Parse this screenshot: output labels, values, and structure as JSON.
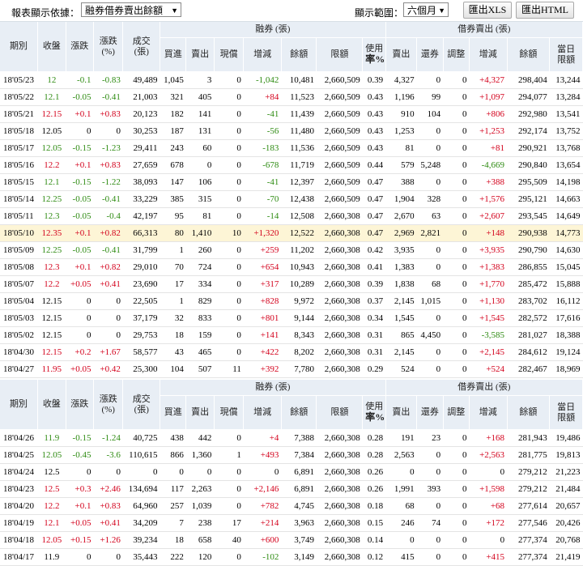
{
  "toolbar": {
    "basis_label": "報表顯示依據：",
    "basis_value": "融券借券賣出餘額",
    "range_label": "顯示範圍：",
    "range_value": "六個月",
    "xls_button": "匯出XLS",
    "html_button": "匯出HTML"
  },
  "header": {
    "date": "期別",
    "close": "收盤",
    "change": "漲跌",
    "pct_a": "漲跌",
    "pct_b": "(%)",
    "vol_a": "成交",
    "vol_b": "(張)",
    "margin_group": "融券 (張)",
    "lending_group": "借券賣出 (張)",
    "buy": "買進",
    "sell": "賣出",
    "spot": "現償",
    "incdec": "增減",
    "balance": "餘額",
    "limit": "限額",
    "usage_a": "使用",
    "usage_b": "率%",
    "l_sell": "賣出",
    "l_return": "還券",
    "l_adjust": "調整",
    "l_incdec": "增減",
    "l_balance": "餘額",
    "l_day_a": "當日",
    "l_day_b": "限額"
  },
  "colors": {
    "up": "#d3001b",
    "down": "#2e8b12",
    "header_bg": "#e8eef5",
    "highlight_bg": "#fdf5d6"
  },
  "rows": [
    {
      "date": "18'05/23",
      "close": "12",
      "chg": "-0.1",
      "pct": "-0.83",
      "vol": "49,489",
      "buy": "1,045",
      "sell": "3",
      "spot": "0",
      "inc": "-1,042",
      "bal": "10,481",
      "lim": "2,660,509",
      "use": "0.39",
      "ls": "4,327",
      "lr": "0",
      "la": "0",
      "li": "+4,327",
      "lb": "298,404",
      "ld": "13,244"
    },
    {
      "date": "18'05/22",
      "close": "12.1",
      "chg": "-0.05",
      "pct": "-0.41",
      "vol": "21,003",
      "buy": "321",
      "sell": "405",
      "spot": "0",
      "inc": "+84",
      "bal": "11,523",
      "lim": "2,660,509",
      "use": "0.43",
      "ls": "1,196",
      "lr": "99",
      "la": "0",
      "li": "+1,097",
      "lb": "294,077",
      "ld": "13,284"
    },
    {
      "date": "18'05/21",
      "close": "12.15",
      "chg": "+0.1",
      "pct": "+0.83",
      "vol": "20,123",
      "buy": "182",
      "sell": "141",
      "spot": "0",
      "inc": "-41",
      "bal": "11,439",
      "lim": "2,660,509",
      "use": "0.43",
      "ls": "910",
      "lr": "104",
      "la": "0",
      "li": "+806",
      "lb": "292,980",
      "ld": "13,541"
    },
    {
      "date": "18'05/18",
      "close": "12.05",
      "chg": "0",
      "pct": "0",
      "vol": "30,253",
      "buy": "187",
      "sell": "131",
      "spot": "0",
      "inc": "-56",
      "bal": "11,480",
      "lim": "2,660,509",
      "use": "0.43",
      "ls": "1,253",
      "lr": "0",
      "la": "0",
      "li": "+1,253",
      "lb": "292,174",
      "ld": "13,752"
    },
    {
      "date": "18'05/17",
      "close": "12.05",
      "chg": "-0.15",
      "pct": "-1.23",
      "vol": "29,411",
      "buy": "243",
      "sell": "60",
      "spot": "0",
      "inc": "-183",
      "bal": "11,536",
      "lim": "2,660,509",
      "use": "0.43",
      "ls": "81",
      "lr": "0",
      "la": "0",
      "li": "+81",
      "lb": "290,921",
      "ld": "13,768"
    },
    {
      "date": "18'05/16",
      "close": "12.2",
      "chg": "+0.1",
      "pct": "+0.83",
      "vol": "27,659",
      "buy": "678",
      "sell": "0",
      "spot": "0",
      "inc": "-678",
      "bal": "11,719",
      "lim": "2,660,509",
      "use": "0.44",
      "ls": "579",
      "lr": "5,248",
      "la": "0",
      "li": "-4,669",
      "lb": "290,840",
      "ld": "13,654"
    },
    {
      "date": "18'05/15",
      "close": "12.1",
      "chg": "-0.15",
      "pct": "-1.22",
      "vol": "38,093",
      "buy": "147",
      "sell": "106",
      "spot": "0",
      "inc": "-41",
      "bal": "12,397",
      "lim": "2,660,509",
      "use": "0.47",
      "ls": "388",
      "lr": "0",
      "la": "0",
      "li": "+388",
      "lb": "295,509",
      "ld": "14,198"
    },
    {
      "date": "18'05/14",
      "close": "12.25",
      "chg": "-0.05",
      "pct": "-0.41",
      "vol": "33,229",
      "buy": "385",
      "sell": "315",
      "spot": "0",
      "inc": "-70",
      "bal": "12,438",
      "lim": "2,660,509",
      "use": "0.47",
      "ls": "1,904",
      "lr": "328",
      "la": "0",
      "li": "+1,576",
      "lb": "295,121",
      "ld": "14,663"
    },
    {
      "date": "18'05/11",
      "close": "12.3",
      "chg": "-0.05",
      "pct": "-0.4",
      "vol": "42,197",
      "buy": "95",
      "sell": "81",
      "spot": "0",
      "inc": "-14",
      "bal": "12,508",
      "lim": "2,660,308",
      "use": "0.47",
      "ls": "2,670",
      "lr": "63",
      "la": "0",
      "li": "+2,607",
      "lb": "293,545",
      "ld": "14,649"
    },
    {
      "date": "18'05/10",
      "close": "12.35",
      "chg": "+0.1",
      "pct": "+0.82",
      "vol": "66,313",
      "buy": "80",
      "sell": "1,410",
      "spot": "10",
      "inc": "+1,320",
      "bal": "12,522",
      "lim": "2,660,308",
      "use": "0.47",
      "ls": "2,969",
      "lr": "2,821",
      "la": "0",
      "li": "+148",
      "lb": "290,938",
      "ld": "14,773",
      "hl": true
    },
    {
      "date": "18'05/09",
      "close": "12.25",
      "chg": "-0.05",
      "pct": "-0.41",
      "vol": "31,799",
      "buy": "1",
      "sell": "260",
      "spot": "0",
      "inc": "+259",
      "bal": "11,202",
      "lim": "2,660,308",
      "use": "0.42",
      "ls": "3,935",
      "lr": "0",
      "la": "0",
      "li": "+3,935",
      "lb": "290,790",
      "ld": "14,630"
    },
    {
      "date": "18'05/08",
      "close": "12.3",
      "chg": "+0.1",
      "pct": "+0.82",
      "vol": "29,010",
      "buy": "70",
      "sell": "724",
      "spot": "0",
      "inc": "+654",
      "bal": "10,943",
      "lim": "2,660,308",
      "use": "0.41",
      "ls": "1,383",
      "lr": "0",
      "la": "0",
      "li": "+1,383",
      "lb": "286,855",
      "ld": "15,045"
    },
    {
      "date": "18'05/07",
      "close": "12.2",
      "chg": "+0.05",
      "pct": "+0.41",
      "vol": "23,690",
      "buy": "17",
      "sell": "334",
      "spot": "0",
      "inc": "+317",
      "bal": "10,289",
      "lim": "2,660,308",
      "use": "0.39",
      "ls": "1,838",
      "lr": "68",
      "la": "0",
      "li": "+1,770",
      "lb": "285,472",
      "ld": "15,888"
    },
    {
      "date": "18'05/04",
      "close": "12.15",
      "chg": "0",
      "pct": "0",
      "vol": "22,505",
      "buy": "1",
      "sell": "829",
      "spot": "0",
      "inc": "+828",
      "bal": "9,972",
      "lim": "2,660,308",
      "use": "0.37",
      "ls": "2,145",
      "lr": "1,015",
      "la": "0",
      "li": "+1,130",
      "lb": "283,702",
      "ld": "16,112"
    },
    {
      "date": "18'05/03",
      "close": "12.15",
      "chg": "0",
      "pct": "0",
      "vol": "37,179",
      "buy": "32",
      "sell": "833",
      "spot": "0",
      "inc": "+801",
      "bal": "9,144",
      "lim": "2,660,308",
      "use": "0.34",
      "ls": "1,545",
      "lr": "0",
      "la": "0",
      "li": "+1,545",
      "lb": "282,572",
      "ld": "17,616"
    },
    {
      "date": "18'05/02",
      "close": "12.15",
      "chg": "0",
      "pct": "0",
      "vol": "29,753",
      "buy": "18",
      "sell": "159",
      "spot": "0",
      "inc": "+141",
      "bal": "8,343",
      "lim": "2,660,308",
      "use": "0.31",
      "ls": "865",
      "lr": "4,450",
      "la": "0",
      "li": "-3,585",
      "lb": "281,027",
      "ld": "18,388"
    },
    {
      "date": "18'04/30",
      "close": "12.15",
      "chg": "+0.2",
      "pct": "+1.67",
      "vol": "58,577",
      "buy": "43",
      "sell": "465",
      "spot": "0",
      "inc": "+422",
      "bal": "8,202",
      "lim": "2,660,308",
      "use": "0.31",
      "ls": "2,145",
      "lr": "0",
      "la": "0",
      "li": "+2,145",
      "lb": "284,612",
      "ld": "19,124"
    },
    {
      "date": "18'04/27",
      "close": "11.95",
      "chg": "+0.05",
      "pct": "+0.42",
      "vol": "25,300",
      "buy": "104",
      "sell": "507",
      "spot": "11",
      "inc": "+392",
      "bal": "7,780",
      "lim": "2,660,308",
      "use": "0.29",
      "ls": "524",
      "lr": "0",
      "la": "0",
      "li": "+524",
      "lb": "282,467",
      "ld": "18,969"
    }
  ],
  "rows2": [
    {
      "date": "18'04/26",
      "close": "11.9",
      "chg": "-0.15",
      "pct": "-1.24",
      "vol": "40,725",
      "buy": "438",
      "sell": "442",
      "spot": "0",
      "inc": "+4",
      "bal": "7,388",
      "lim": "2,660,308",
      "use": "0.28",
      "ls": "191",
      "lr": "23",
      "la": "0",
      "li": "+168",
      "lb": "281,943",
      "ld": "19,486"
    },
    {
      "date": "18'04/25",
      "close": "12.05",
      "chg": "-0.45",
      "pct": "-3.6",
      "vol": "110,615",
      "buy": "866",
      "sell": "1,360",
      "spot": "1",
      "inc": "+493",
      "bal": "7,384",
      "lim": "2,660,308",
      "use": "0.28",
      "ls": "2,563",
      "lr": "0",
      "la": "0",
      "li": "+2,563",
      "lb": "281,775",
      "ld": "19,813"
    },
    {
      "date": "18'04/24",
      "close": "12.5",
      "chg": "0",
      "pct": "0",
      "vol": "0",
      "buy": "0",
      "sell": "0",
      "spot": "0",
      "inc": "0",
      "bal": "6,891",
      "lim": "2,660,308",
      "use": "0.26",
      "ls": "0",
      "lr": "0",
      "la": "0",
      "li": "0",
      "lb": "279,212",
      "ld": "21,223"
    },
    {
      "date": "18'04/23",
      "close": "12.5",
      "chg": "+0.3",
      "pct": "+2.46",
      "vol": "134,694",
      "buy": "117",
      "sell": "2,263",
      "spot": "0",
      "inc": "+2,146",
      "bal": "6,891",
      "lim": "2,660,308",
      "use": "0.26",
      "ls": "1,991",
      "lr": "393",
      "la": "0",
      "li": "+1,598",
      "lb": "279,212",
      "ld": "21,484"
    },
    {
      "date": "18'04/20",
      "close": "12.2",
      "chg": "+0.1",
      "pct": "+0.83",
      "vol": "64,960",
      "buy": "257",
      "sell": "1,039",
      "spot": "0",
      "inc": "+782",
      "bal": "4,745",
      "lim": "2,660,308",
      "use": "0.18",
      "ls": "68",
      "lr": "0",
      "la": "0",
      "li": "+68",
      "lb": "277,614",
      "ld": "20,657"
    },
    {
      "date": "18'04/19",
      "close": "12.1",
      "chg": "+0.05",
      "pct": "+0.41",
      "vol": "34,209",
      "buy": "7",
      "sell": "238",
      "spot": "17",
      "inc": "+214",
      "bal": "3,963",
      "lim": "2,660,308",
      "use": "0.15",
      "ls": "246",
      "lr": "74",
      "la": "0",
      "li": "+172",
      "lb": "277,546",
      "ld": "20,426"
    },
    {
      "date": "18'04/18",
      "close": "12.05",
      "chg": "+0.15",
      "pct": "+1.26",
      "vol": "39,234",
      "buy": "18",
      "sell": "658",
      "spot": "40",
      "inc": "+600",
      "bal": "3,749",
      "lim": "2,660,308",
      "use": "0.14",
      "ls": "0",
      "lr": "0",
      "la": "0",
      "li": "0",
      "lb": "277,374",
      "ld": "20,768"
    },
    {
      "date": "18'04/17",
      "close": "11.9",
      "chg": "0",
      "pct": "0",
      "vol": "35,443",
      "buy": "222",
      "sell": "120",
      "spot": "0",
      "inc": "-102",
      "bal": "3,149",
      "lim": "2,660,308",
      "use": "0.12",
      "ls": "415",
      "lr": "0",
      "la": "0",
      "li": "+415",
      "lb": "277,374",
      "ld": "21,419"
    }
  ]
}
